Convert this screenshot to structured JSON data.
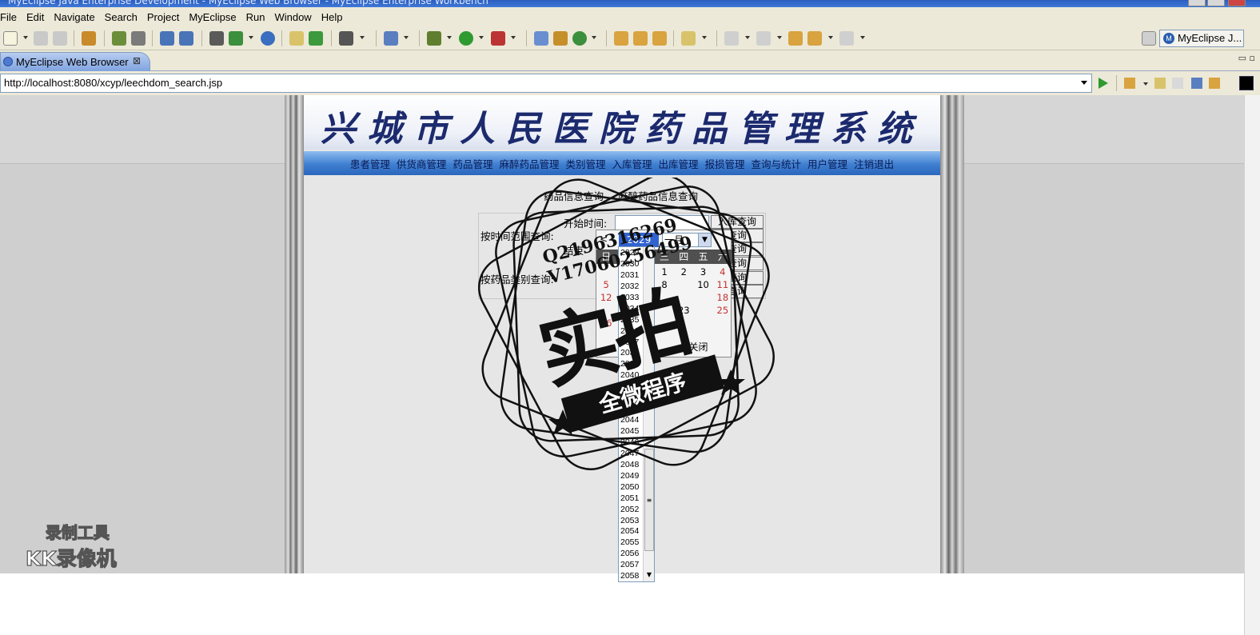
{
  "window": {
    "title": "MyEclipse Java Enterprise Development - MyEclipse Web Browser - MyEclipse Enterprise Workbench"
  },
  "menu": [
    "File",
    "Edit",
    "Navigate",
    "Search",
    "Project",
    "MyEclipse",
    "Run",
    "Window",
    "Help"
  ],
  "perspective": {
    "label": "MyEclipse J..."
  },
  "editor_tab": {
    "label": "MyEclipse Web Browser",
    "close": "⊠"
  },
  "address": {
    "url": "http://localhost:8080/xcyp/leechdom_search.jsp"
  },
  "page": {
    "title": "兴城市人民医院药品管理系统",
    "nav": [
      "患者管理",
      "供货商管理",
      "药品管理",
      "麻醉药品管理",
      "类别管理",
      "入库管理",
      "出库管理",
      "报损管理",
      "查询与统计",
      "用户管理",
      "注销退出"
    ],
    "subtabs": [
      "药品信息查询",
      "麻醉药品信息查询"
    ],
    "form": {
      "time_range_label": "按时间范围查询:",
      "start_label": "开始时间:",
      "end_label": "结束",
      "category_label": "按药品类别查询:",
      "buttons": [
        "入库查询",
        "查询",
        "查询",
        "查询",
        "查询",
        "查询"
      ]
    }
  },
  "calendar": {
    "prev": "<",
    "year": "2029",
    "month": "一月",
    "weekdays": [
      "日",
      "一",
      "二",
      "三",
      "四",
      "五",
      "六"
    ],
    "weeks": [
      [
        "",
        "",
        "",
        "1",
        "2",
        "3",
        "4"
      ],
      [
        "5",
        "",
        "",
        "8",
        "",
        "10",
        "11"
      ],
      [
        "12",
        "",
        "",
        "",
        "",
        "",
        "18"
      ],
      [
        "",
        "",
        "",
        "",
        "23",
        "",
        "25"
      ],
      [
        "26",
        "",
        "",
        "",
        "",
        "",
        ""
      ]
    ],
    "today": "今天",
    "close": "关闭"
  },
  "year_dropdown": {
    "years": [
      "2029",
      "2030",
      "2031",
      "2032",
      "2033",
      "2034",
      "2035",
      "2036",
      "2037",
      "2038",
      "2039",
      "2040",
      "2041",
      "2042",
      "2043",
      "2044",
      "2045",
      "2046",
      "2047",
      "2048",
      "2049",
      "2050",
      "2051",
      "2052",
      "2053",
      "2054",
      "2055",
      "2056",
      "2057",
      "2058"
    ]
  },
  "watermark": {
    "contact_q": "Q2196316269",
    "contact_v": "V17060256499",
    "main": "实拍",
    "ribbon": "全微程序"
  },
  "recorder_watermark": {
    "line1": "录制工具",
    "line2": "KK录像机"
  }
}
